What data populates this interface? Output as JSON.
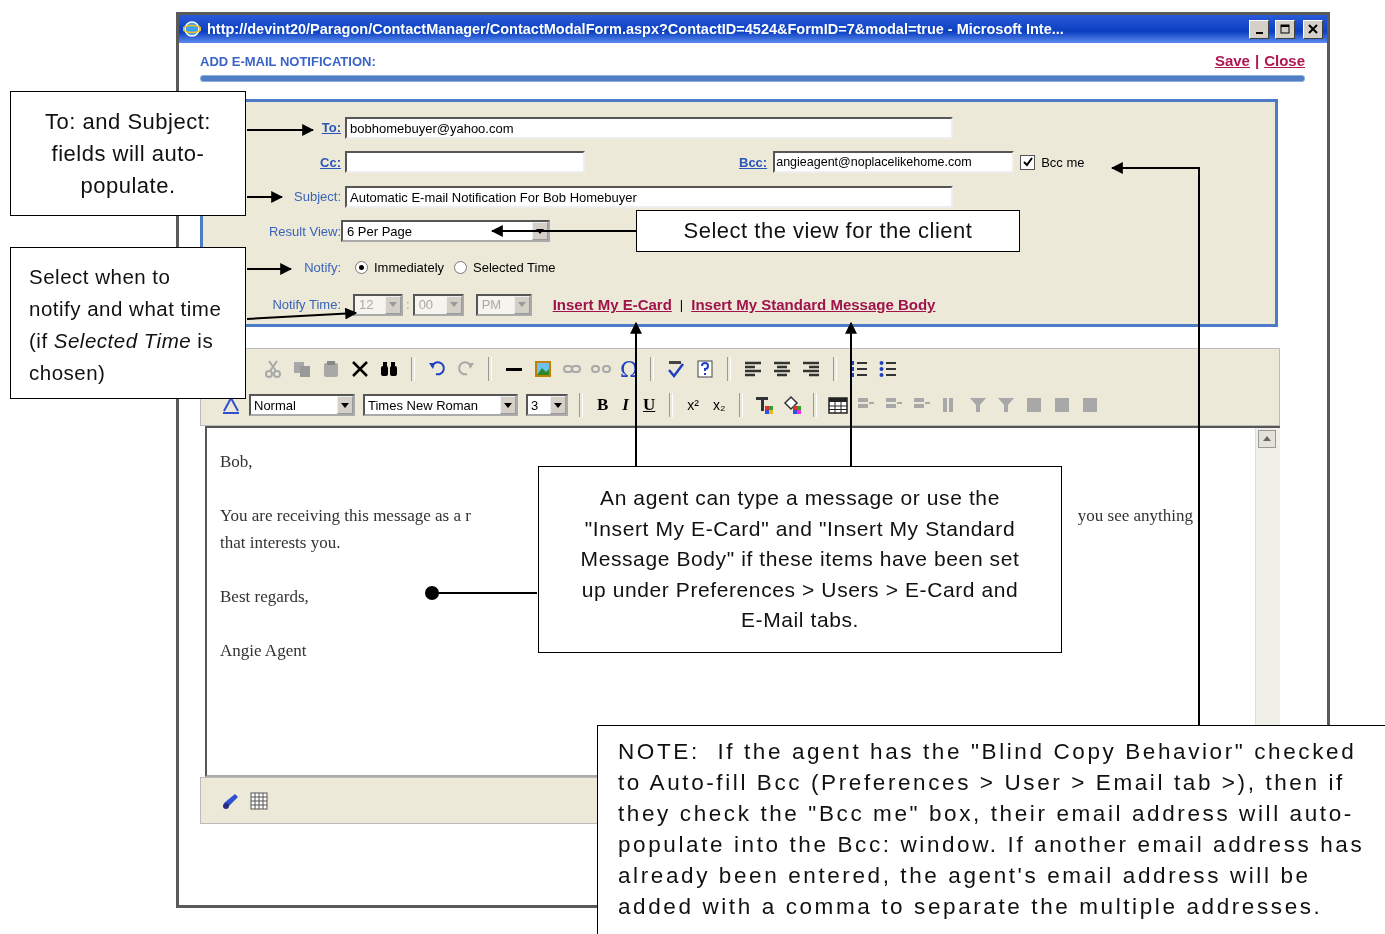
{
  "window": {
    "title": "http://devint20/Paragon/ContactManager/ContactModalForm.aspx?ContactID=4524&FormID=7&modal=true - Microsoft Inte..."
  },
  "header": {
    "title": "ADD E-MAIL NOTIFICATION:",
    "links": [
      "Save",
      "Close"
    ],
    "separator": "|"
  },
  "form": {
    "to": {
      "label": "To:",
      "value": "bobhomebuyer@yahoo.com"
    },
    "cc": {
      "label": "Cc:"
    },
    "bcc": {
      "label": "Bcc:",
      "value": "angieagent@noplacelikehome.com"
    },
    "bcc_me": {
      "label": "Bcc me",
      "checked": true
    },
    "subject": {
      "label": "Subject:",
      "value": "Automatic E-mail Notification For Bob Homebuyer"
    },
    "result_view": {
      "label": "Result View:",
      "value": "6 Per Page"
    },
    "notify": {
      "label": "Notify:",
      "options": [
        {
          "label": "Immediately",
          "selected": true
        },
        {
          "label": "Selected Time",
          "selected": false
        }
      ]
    },
    "notify_time": {
      "label": "Notify Time:",
      "hour": "12",
      "separator": ":",
      "minute": "00",
      "ampm": "PM",
      "disabled": true
    },
    "insert_links": [
      "Insert My E-Card",
      "Insert My Standard Message Body"
    ],
    "insert_separator": "|"
  },
  "editor": {
    "omega": "Ω",
    "format": "Normal",
    "font": "Times New Roman",
    "size": "3",
    "bold": "B",
    "italic": "I",
    "underline": "U",
    "superscript": "x²",
    "subscript": "x₂",
    "body": [
      {
        "kind": "line",
        "text": "Bob,"
      },
      {
        "kind": "split",
        "left": "You are receiving this message as a r",
        "right": "you see anything"
      },
      {
        "kind": "cont",
        "text": "that interests you."
      },
      {
        "kind": "line",
        "text": "Best regards,"
      },
      {
        "kind": "line",
        "text": "Angie Agent"
      }
    ]
  },
  "callouts": [
    {
      "text": "To: and Subject: fields will auto-populate."
    },
    {
      "text": "Select the view for the client"
    },
    {
      "text": "Select when to notify and what time (if *Selected Time* is chosen)"
    },
    {
      "text": "An agent can type a message or use the \"Insert My E-Card\" and \"Insert My Standard Message Body\" if these items have been set up under Preferences > Users > E-Card and E-Mail tabs."
    },
    {
      "text": "NOTE:  If the agent has the \"Blind Copy Behavior\" checked to Auto-fill Bcc (Preferences > User > Email tab >), then if they check the \"Bcc me\" box, their email address will auto-populate into the Bcc: window. If another email address has already been entered, the agent's email address will be added with a comma to separate the multiple addresses."
    }
  ]
}
